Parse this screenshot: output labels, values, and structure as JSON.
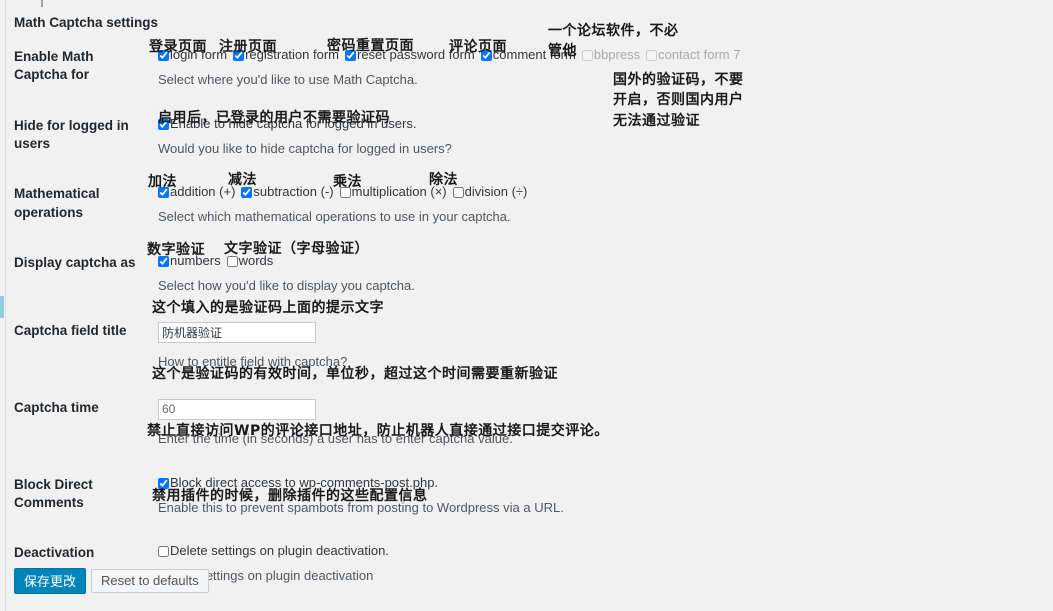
{
  "section": {
    "heading": "Math Captcha settings"
  },
  "rows": {
    "enable_for": {
      "label": "Enable Math Captcha for",
      "checkboxes": [
        {
          "label": "login form",
          "checked": true,
          "disabled": false
        },
        {
          "label": "registration form",
          "checked": true,
          "disabled": false
        },
        {
          "label": "reset password form",
          "checked": true,
          "disabled": false
        },
        {
          "label": "comment form",
          "checked": true,
          "disabled": false
        },
        {
          "label": "bbpress",
          "checked": false,
          "disabled": true
        },
        {
          "label": "contact form 7",
          "checked": false,
          "disabled": true
        }
      ],
      "description": "Select where you'd like to use Math Captcha."
    },
    "hide_logged_in": {
      "label": "Hide for logged in users",
      "checkbox": {
        "label": "Enable to hide captcha for logged in users.",
        "checked": true
      },
      "description": "Would you like to hide captcha for logged in users?"
    },
    "math_ops": {
      "label": "Mathematical operations",
      "checkboxes": [
        {
          "label": "addition (+)",
          "checked": true
        },
        {
          "label": "subtraction (-)",
          "checked": true
        },
        {
          "label": "multiplication (×)",
          "checked": false
        },
        {
          "label": "division (÷)",
          "checked": false
        }
      ],
      "description": "Select which mathematical operations to use in your captcha."
    },
    "display_as": {
      "label": "Display captcha as",
      "checkboxes": [
        {
          "label": "numbers",
          "checked": true
        },
        {
          "label": "words",
          "checked": false
        }
      ],
      "description": "Select how you'd like to display you captcha."
    },
    "field_title": {
      "label": "Captcha field title",
      "value": "防机器验证",
      "placeholder": "",
      "description": "How to entitle field with captcha?"
    },
    "captcha_time": {
      "label": "Captcha time",
      "value": "60",
      "placeholder": "60",
      "description": "Enter the time (in seconds) a user has to enter captcha value."
    },
    "block_direct": {
      "label": "Block Direct Comments",
      "checkbox": {
        "label": "Block direct access to wp-comments-post.php.",
        "checked": true
      },
      "description": "Enable this to prevent spambots from posting to Wordpress via a URL."
    },
    "deactivation": {
      "label": "Deactivation",
      "checkbox": {
        "label": "Delete settings on plugin deactivation.",
        "checked": false
      },
      "description": "Delete settings on plugin deactivation"
    }
  },
  "annotations": {
    "login_page": "登录页面",
    "register_page": "注册页面",
    "reset_password_page": "密码重置页面",
    "comment_page": "评论页面",
    "forum_note": "一个论坛软件，不必\n管他",
    "foreign_captcha_note": "国外的验证码，不要\n开启，否则国内用户\n无法通过验证",
    "logged_in_note": "启用后，已登录的用户不需要验证码",
    "addition": "加法",
    "subtraction": "减法",
    "multiplication": "乘法",
    "division": "除法",
    "numbers": "数字验证",
    "words": "文字验证（字母验证）",
    "field_title_note": "这个填入的是验证码上面的提示文字",
    "captcha_time_note": "这个是验证码的有效时间，单位秒，超过这个时间需要重新验证",
    "block_direct_note": "禁止直接访问WP的评论接口地址，防止机器人直接通过接口提交评论。",
    "deactivation_note": "禁用插件的时候，删除插件的这些配置信息"
  },
  "buttons": {
    "save": "保存更改",
    "reset": "Reset to defaults"
  },
  "colors": {
    "primary": "#0085ba",
    "background": "#f1f1f1",
    "text": "#444444",
    "disabled_text": "#a7aaad"
  }
}
